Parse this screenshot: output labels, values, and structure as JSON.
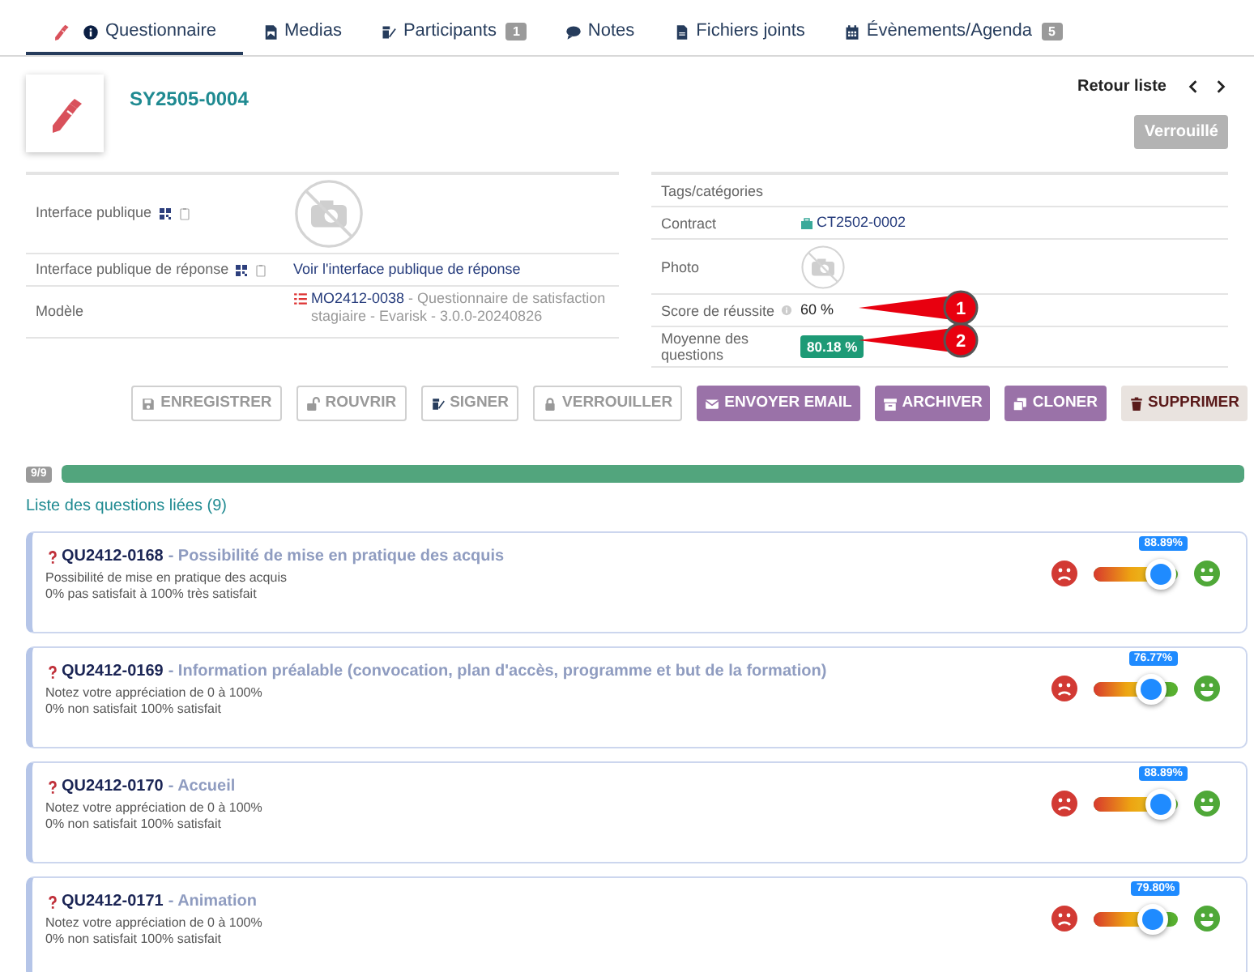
{
  "tabs": [
    {
      "label": "Questionnaire",
      "selected": true
    },
    {
      "label": "Medias",
      "selected": false
    },
    {
      "label": "Participants",
      "badge": "1",
      "selected": false
    },
    {
      "label": "Notes",
      "selected": false
    },
    {
      "label": "Fichiers joints",
      "selected": false
    },
    {
      "label": "Évènements/Agenda",
      "badge": "5",
      "selected": false
    }
  ],
  "header": {
    "ref": "SY2505-0004",
    "back_link": "Retour liste",
    "status": "Verrouillé"
  },
  "left_fields": [
    {
      "kind": "picture",
      "label": "Interface publique"
    },
    {
      "kind": "link",
      "label": "Interface publique de réponse",
      "value": "Voir l'interface publique de réponse"
    },
    {
      "kind": "model",
      "label": "Modèle",
      "ref": "MO2412-0038",
      "value": "- Questionnaire de satisfaction stagiaire - Evarisk - 3.0.0-20240826"
    }
  ],
  "right_fields": [
    {
      "kind": "empty",
      "label": "Tags/catégories"
    },
    {
      "kind": "contract",
      "label": "Contract",
      "value": "CT2502-0002"
    },
    {
      "kind": "photo",
      "label": "Photo"
    },
    {
      "kind": "text",
      "label": "Score de réussite",
      "info": true,
      "value": "60 %",
      "callout": "1"
    },
    {
      "kind": "badge",
      "label": "Moyenne des questions",
      "value": "80.18 %",
      "callout": "2"
    }
  ],
  "actions": [
    {
      "label": "ENREGISTRER",
      "kind": "outline"
    },
    {
      "label": "ROUVRIR",
      "kind": "outline"
    },
    {
      "label": "SIGNER",
      "kind": "outline"
    },
    {
      "label": "VERROUILLER",
      "kind": "outline"
    },
    {
      "label": "ENVOYER EMAIL",
      "kind": "primary"
    },
    {
      "label": "ARCHIVER",
      "kind": "primary"
    },
    {
      "label": "CLONER",
      "kind": "primary"
    },
    {
      "label": "SUPPRIMER",
      "kind": "danger"
    }
  ],
  "progress": {
    "count": "9/9",
    "level": 1
  },
  "questions_title": "Liste des questions liées (9)",
  "questions": [
    {
      "ref": "QU2412-0168",
      "title": "- Possibilité de mise en pratique des acquis",
      "description": "Possibilité de mise en pratique des acquis",
      "scale": "0% pas satisfait à 100% très satisfait",
      "reading": "88.89%",
      "level": 0.8889
    },
    {
      "ref": "QU2412-0169",
      "title": "- Information préalable (convocation, plan d'accès, programme et but de la formation)",
      "description": "Notez votre appréciation de 0 à 100%",
      "scale": "0% non satisfait 100% satisfait",
      "reading": "76.77%",
      "level": 0.7677
    },
    {
      "ref": "QU2412-0170",
      "title": "- Accueil",
      "description": "Notez votre appréciation de 0 à 100%",
      "scale": "0% non satisfait 100% satisfait",
      "reading": "88.89%",
      "level": 0.8889
    },
    {
      "ref": "QU2412-0171",
      "title": "- Animation",
      "description": "Notez votre appréciation de 0 à 100%",
      "scale": "0% non satisfait 100% satisfait",
      "reading": "79.80%",
      "level": 0.798
    }
  ]
}
